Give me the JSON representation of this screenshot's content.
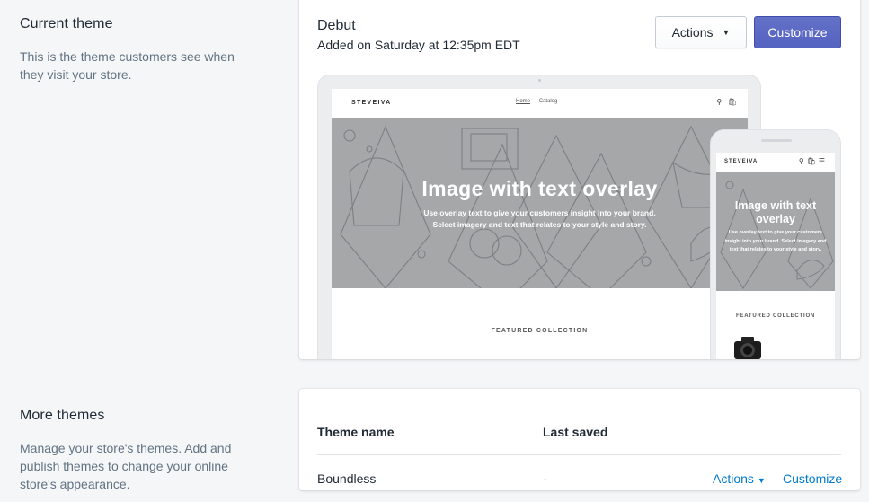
{
  "current_theme": {
    "heading": "Current theme",
    "description": "This is the theme customers see when they visit your store.",
    "theme_name": "Debut",
    "added_on": "Added on Saturday at 12:35pm EDT",
    "actions_label": "Actions",
    "customize_label": "Customize",
    "preview": {
      "store_logo": "STEVEIVA",
      "nav_home": "Home",
      "nav_catalog": "Catalog",
      "hero_title": "Image with text overlay",
      "hero_subtitle_line1": "Use overlay text to give your customers insight into your brand.",
      "hero_subtitle_line2": "Select imagery and text that relates to your style and story.",
      "mobile_hero_title": "Image with text overlay",
      "mobile_hero_subtitle": "Use overlay text to give your customers insight into your brand. Select imagery and text that relates to your style and story.",
      "featured_label": "FEATURED COLLECTION"
    }
  },
  "more_themes": {
    "heading": "More themes",
    "description": "Manage your store's themes. Add and publish themes to change your online store's appearance.",
    "columns": [
      "Theme name",
      "Last saved"
    ],
    "rows": [
      {
        "name": "Boundless",
        "last_saved": "-",
        "actions_label": "Actions",
        "customize_label": "Customize"
      }
    ]
  },
  "colors": {
    "primary_button": "#5c6ac4",
    "link": "#007ace",
    "hero_gray": "#a5a7a9"
  }
}
